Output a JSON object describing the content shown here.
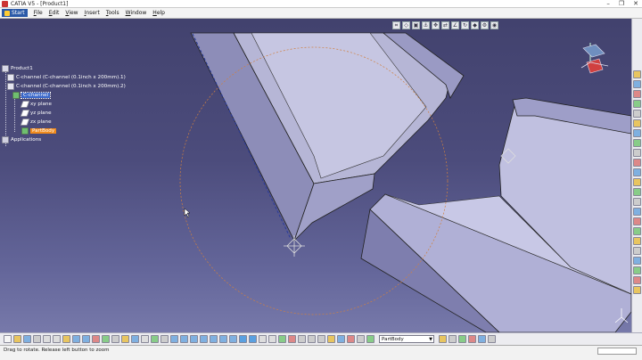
{
  "window": {
    "title": "CATIA V5 - [Product1]",
    "controls": [
      "–",
      "❐",
      "✕"
    ]
  },
  "menubar": {
    "start_label": "Start",
    "items": [
      "File",
      "Edit",
      "View",
      "Insert",
      "Tools",
      "Window",
      "Help"
    ]
  },
  "tree": {
    "root": "Product1",
    "children": [
      {
        "label": "C-channel (C-channel (0.1inch x 200mm).1)"
      },
      {
        "label": "C-channel (C-channel (0.1inch x 200mm).2)"
      }
    ],
    "part": "C-channel",
    "planes": [
      "xy plane",
      "yz plane",
      "zx plane"
    ],
    "body": "PartBody",
    "applications": "Applications"
  },
  "toolbar": {
    "part_body_select": "PartBody"
  },
  "status": {
    "message": "Drag to rotate. Release left button to zoom"
  },
  "icons": {
    "compass": "compass-icon",
    "cursor": "cursor-icon",
    "axis_triad": "axis-triad-icon"
  },
  "colors": {
    "viewport_top": "#42426e",
    "viewport_bottom": "#7779aa",
    "part_face": "#a8a8cc",
    "selection_orange": "#f08a1c",
    "selection_blue": "#3a67c9"
  }
}
